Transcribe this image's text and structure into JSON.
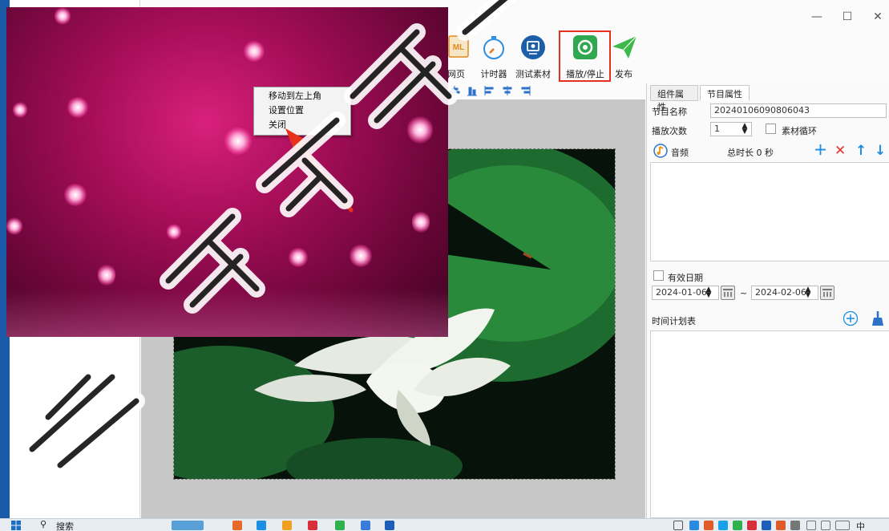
{
  "window": {
    "minimize_glyph": "—",
    "maximize_glyph": "☐",
    "close_glyph": "✕"
  },
  "toolbar": {
    "items": [
      {
        "label": "网页",
        "icon": "html-icon"
      },
      {
        "label": "计时器",
        "icon": "timer-icon"
      },
      {
        "label": "测试素材",
        "icon": "test-material-icon"
      },
      {
        "label": "播放/停止",
        "icon": "play-stop-icon"
      },
      {
        "label": "发布",
        "icon": "publish-icon"
      }
    ]
  },
  "context_menu": {
    "items": [
      "移动到左上角",
      "设置位置",
      "关闭"
    ]
  },
  "properties": {
    "tabs": [
      "组件属性",
      "节目属性"
    ],
    "active_tab": "节目属性",
    "program_name_label": "节目名称",
    "program_name_value": "20240106090806043",
    "play_count_label": "播放次数",
    "play_count_value": "1",
    "material_loop_label": "素材循环",
    "audio_label": "音频",
    "total_duration": "总时长 0 秒",
    "valid_date_label": "有效日期",
    "start_date": "2024-01-06",
    "date_separator": "~",
    "end_date": "2024-02-06",
    "schedule_label": "时间计划表"
  },
  "taskbar": {
    "search_label": "搜索",
    "lang_label": "中"
  },
  "colors": {
    "highlight_border": "#e53020",
    "add_action": "#1a8fe3",
    "delete_action": "#e0342a",
    "play_icon_bg": "#2fa84f"
  }
}
